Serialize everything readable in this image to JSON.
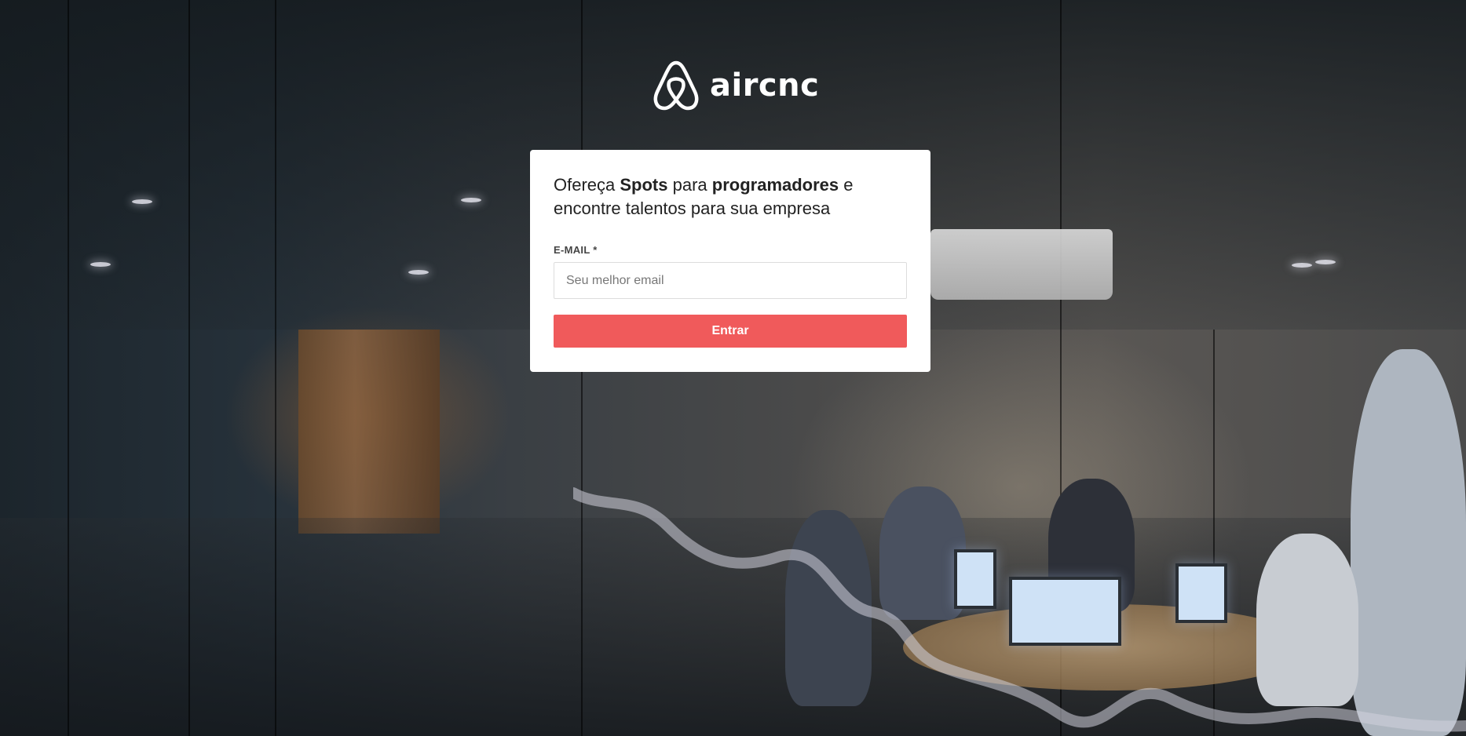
{
  "brand": {
    "logo_text": "aircnc",
    "logo_icon": "airbnb-belo-icon"
  },
  "card": {
    "tagline": {
      "part1": "Ofereça ",
      "spots": "Spots",
      "part2": " para ",
      "programadores": "programadores",
      "part3": " e encontre talentos para sua empresa"
    },
    "email_label": "E-MAIL *",
    "email_value": "",
    "email_placeholder": "Seu melhor email",
    "submit_label": "Entrar"
  },
  "colors": {
    "accent": "#f05a5b",
    "card_bg": "#ffffff",
    "text": "#222222"
  }
}
